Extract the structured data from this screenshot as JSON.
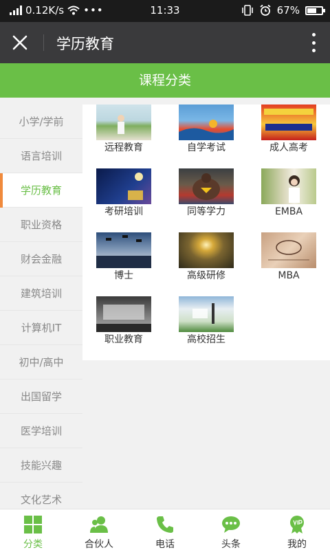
{
  "status_bar": {
    "network_speed": "0.12K/s",
    "time": "11:33",
    "battery": "67%",
    "battery_level": 0.67
  },
  "titlebar": {
    "title": "学历教育"
  },
  "header": {
    "title": "课程分类"
  },
  "sidebar": {
    "items": [
      {
        "label": "小学/学前",
        "active": false
      },
      {
        "label": "语言培训",
        "active": false
      },
      {
        "label": "学历教育",
        "active": true
      },
      {
        "label": "职业资格",
        "active": false
      },
      {
        "label": "财会金融",
        "active": false
      },
      {
        "label": "建筑培训",
        "active": false
      },
      {
        "label": "计算机IT",
        "active": false
      },
      {
        "label": "初中/高中",
        "active": false
      },
      {
        "label": "出国留学",
        "active": false
      },
      {
        "label": "医学培训",
        "active": false
      },
      {
        "label": "技能兴趣",
        "active": false
      },
      {
        "label": "文化艺术",
        "active": false
      }
    ]
  },
  "courses": [
    {
      "label": "远程教育"
    },
    {
      "label": "自学考试"
    },
    {
      "label": "成人高考"
    },
    {
      "label": "考研培训"
    },
    {
      "label": "同等学力"
    },
    {
      "label": "EMBA"
    },
    {
      "label": "博士"
    },
    {
      "label": "高级研修"
    },
    {
      "label": "MBA"
    },
    {
      "label": "职业教育"
    },
    {
      "label": "高校招生"
    }
  ],
  "bottom_nav": {
    "items": [
      {
        "label": "分类",
        "icon": "grid-icon",
        "active": true
      },
      {
        "label": "合伙人",
        "icon": "people-icon",
        "active": false
      },
      {
        "label": "电话",
        "icon": "phone-icon",
        "active": false
      },
      {
        "label": "头条",
        "icon": "chat-icon",
        "active": false
      },
      {
        "label": "我的",
        "icon": "vip-badge-icon",
        "active": false
      }
    ]
  },
  "colors": {
    "accent": "#6abf47",
    "active_marker": "#f08a3c",
    "titlebar": "#3a3a3c",
    "statusbar": "#1b1b1b"
  }
}
